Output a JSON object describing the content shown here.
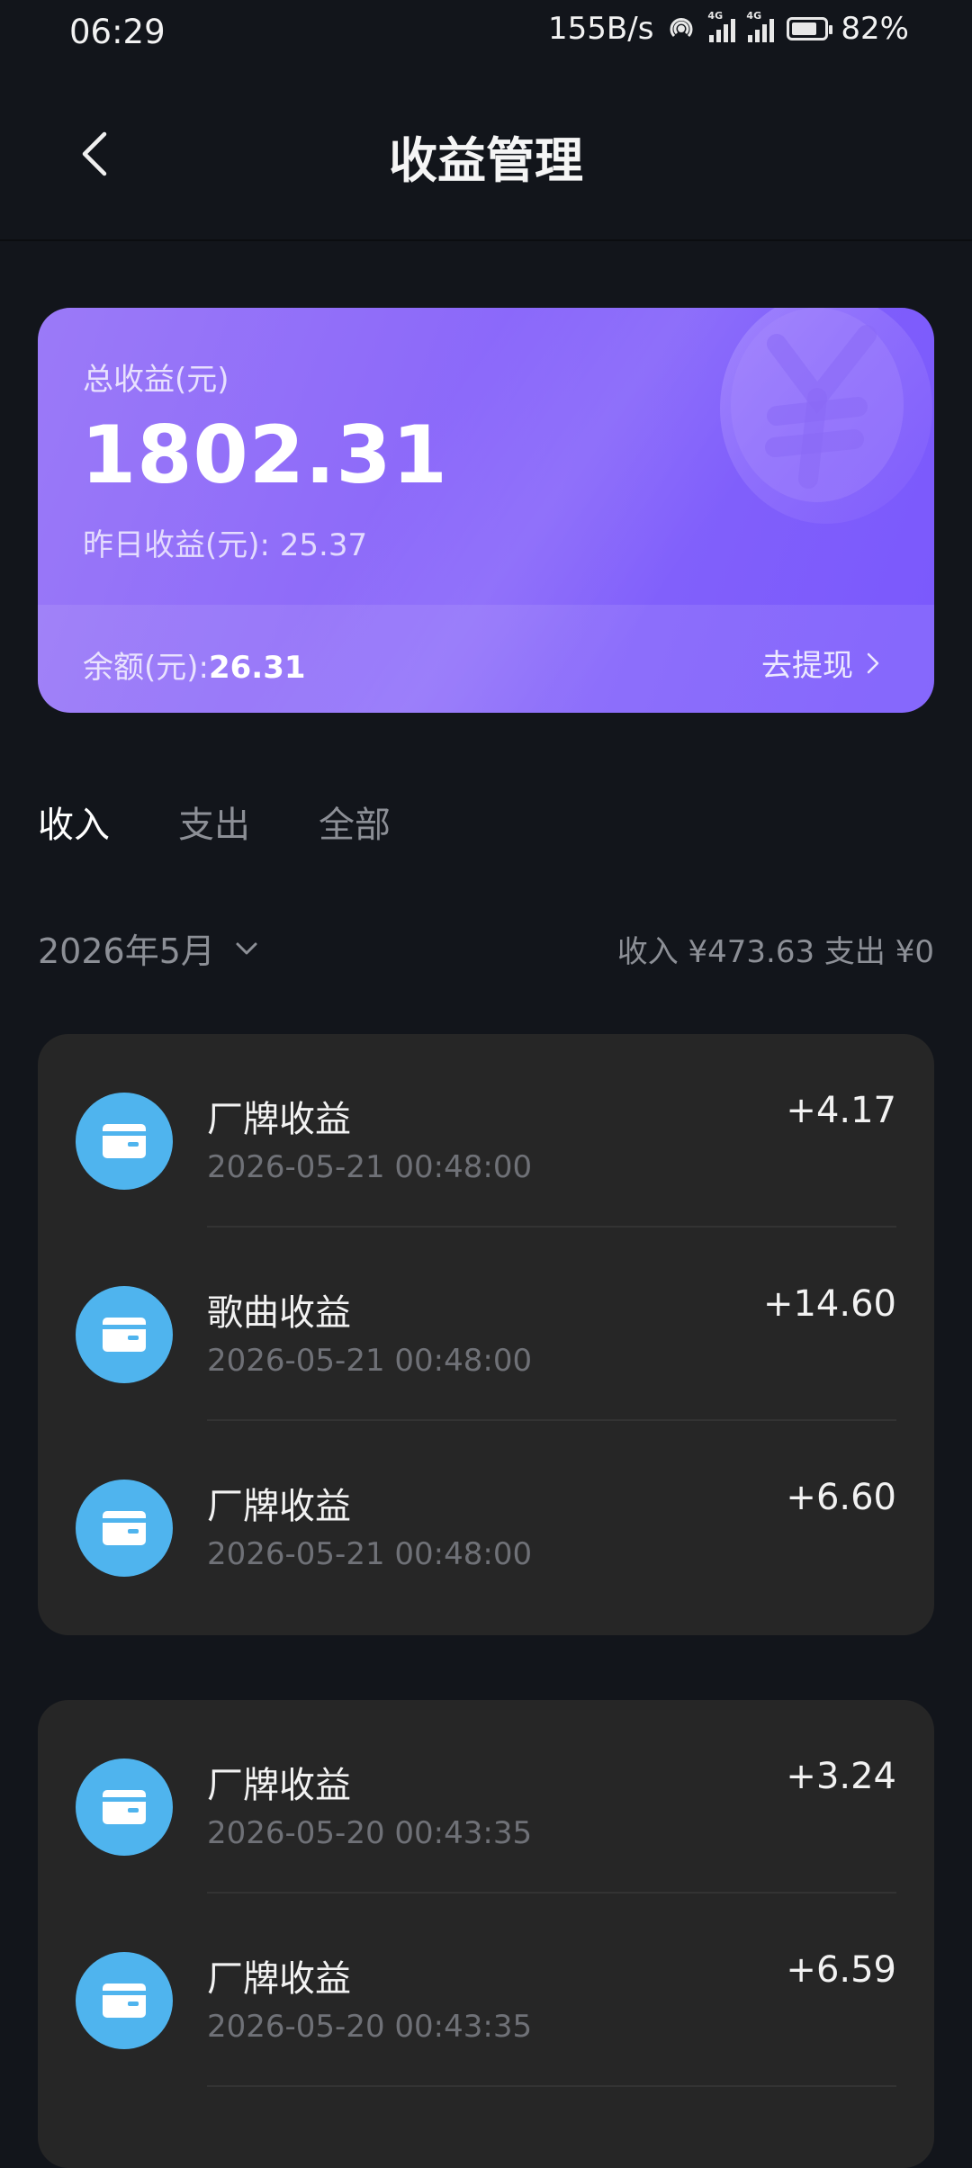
{
  "status_bar": {
    "time": "06:29",
    "net_speed": "155B/s",
    "signal1_label": "4G",
    "signal2_label": "4G",
    "battery_percent": "82%",
    "battery_level": 0.82
  },
  "header": {
    "title": "收益管理"
  },
  "earnings_card": {
    "total_label": "总收益(元)",
    "total_value": "1802.31",
    "yesterday_text": "昨日收益(元): 25.37",
    "balance_label": "余额(元):",
    "balance_value": "26.31",
    "withdraw_label": "去提现"
  },
  "tabs": [
    {
      "label": "收入",
      "active": true
    },
    {
      "label": "支出",
      "active": false
    },
    {
      "label": "全部",
      "active": false
    }
  ],
  "filter": {
    "month": "2026年5月",
    "summary": "收入 ¥473.63 支出 ¥0"
  },
  "groups": [
    {
      "items": [
        {
          "title": "厂牌收益",
          "time": "2026-05-21 00:48:00",
          "amount": "+4.17"
        },
        {
          "title": "歌曲收益",
          "time": "2026-05-21 00:48:00",
          "amount": "+14.60"
        },
        {
          "title": "厂牌收益",
          "time": "2026-05-21 00:48:00",
          "amount": "+6.60"
        }
      ]
    },
    {
      "items": [
        {
          "title": "厂牌收益",
          "time": "2026-05-20 00:43:35",
          "amount": "+3.24"
        },
        {
          "title": "厂牌收益",
          "time": "2026-05-20 00:43:35",
          "amount": "+6.59"
        }
      ]
    }
  ],
  "colors": {
    "background": "#12151b",
    "card_gradient_start": "#9b7af8",
    "card_gradient_end": "#7a58fc",
    "group_background": "#262626",
    "icon_circle": "#4fb4ee",
    "muted_text": "#8c8f96"
  }
}
